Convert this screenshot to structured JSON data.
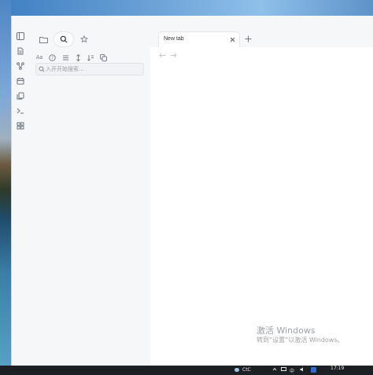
{
  "ribbon": {
    "icons": [
      "sidebar-toggle-icon",
      "new-note-icon",
      "graph-view-icon",
      "daily-notes-icon",
      "templates-icon",
      "command-palette-icon",
      "canvas-icon"
    ]
  },
  "sidebar": {
    "tabs": [
      "file-explorer",
      "search",
      "bookmarks"
    ],
    "active_tab": "search",
    "toolbar_icons": [
      "match-case-icon",
      "explain-query-icon",
      "sort-icon",
      "expand-icon",
      "collapse-icon",
      "copy-results-icon"
    ],
    "match_case_label": "Aa",
    "search": {
      "placeholder": "入开开始搜索...",
      "value": ""
    }
  },
  "main": {
    "tabs": [
      {
        "title": "New tab",
        "active": true
      }
    ],
    "new_tab_symbol": "+",
    "close_symbol": "×"
  },
  "watermark": {
    "title": "激活 Windows",
    "subtitle": "转到“设置”以激活 Windows。"
  },
  "taskbar": {
    "weather": "CtC",
    "ime": "中",
    "time": "17:19"
  },
  "colors": {
    "accent": "#4a7fb5",
    "sidebar_bg": "#f6f7f9",
    "taskbar_bg": "#1c1f24"
  }
}
